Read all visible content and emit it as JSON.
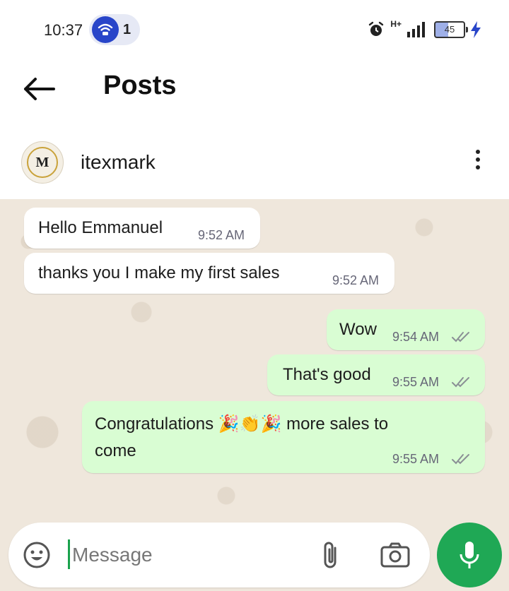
{
  "status_bar": {
    "time": "10:37",
    "hotspot_count": "1",
    "network": "H+",
    "battery": "45"
  },
  "header": {
    "title": "Posts"
  },
  "contact": {
    "name": "itexmark",
    "avatar_letter": "M"
  },
  "messages": [
    {
      "direction": "in",
      "text": "Hello Emmanuel",
      "time": "9:52 AM"
    },
    {
      "direction": "in",
      "text": "thanks you I make my first sales",
      "time": "9:52 AM"
    },
    {
      "direction": "out",
      "text": "Wow",
      "time": "9:54 AM",
      "read": true
    },
    {
      "direction": "out",
      "text": "That's good",
      "time": "9:55 AM",
      "read": true
    },
    {
      "direction": "out",
      "text_line1": "Congratulations 🎉👏🎉 more sales to",
      "text_line2": "come",
      "time": "9:55 AM",
      "read": true
    }
  ],
  "composer": {
    "placeholder": "Message"
  },
  "icons": {
    "back": "arrow-left-icon",
    "more": "more-vert-icon",
    "emoji": "emoji-icon",
    "attach": "paperclip-icon",
    "camera": "camera-icon",
    "mic": "mic-icon"
  },
  "colors": {
    "outgoing_bubble": "#d9fdd3",
    "incoming_bubble": "#ffffff",
    "chat_background": "#efe7dc",
    "accent_green": "#1fa855",
    "read_ticks": "#8a8f95"
  }
}
